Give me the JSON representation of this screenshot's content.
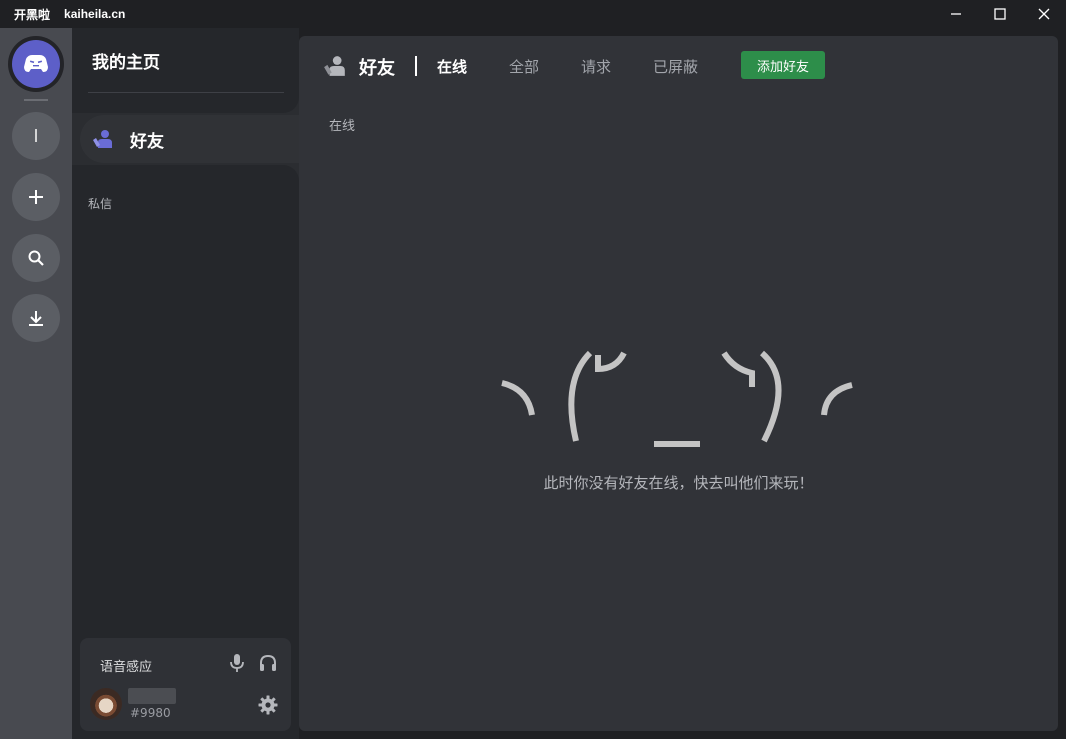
{
  "titlebar": {
    "app_name": "开黑啦",
    "app_domain": "kaiheila.cn"
  },
  "window_controls": {
    "icons": [
      "minimize-icon",
      "maximize-icon",
      "close-icon"
    ]
  },
  "rail": {
    "home_icon": "kaiheila-logo-icon",
    "server_letter": "I",
    "buttons": [
      "add-server-icon",
      "search-icon",
      "download-icon"
    ]
  },
  "sidebar": {
    "title": "我的主页",
    "friends_label": "好友",
    "dm_section_label": "私信"
  },
  "user_panel": {
    "voice_mode": "语音感应",
    "user_tag": "#9980"
  },
  "main": {
    "header_title": "好友",
    "tabs": [
      {
        "label": "在线",
        "active": true
      },
      {
        "label": "全部",
        "active": false
      },
      {
        "label": "请求",
        "active": false
      },
      {
        "label": "已屏蔽",
        "active": false
      }
    ],
    "add_friend_label": "添加好友",
    "section_label": "在线",
    "empty_message": "此时你没有好友在线，快去叫他们来玩！"
  },
  "colors": {
    "accent": "#5d5fc8",
    "add_friend_green": "#2d8e4a",
    "main_bg": "#313338"
  }
}
